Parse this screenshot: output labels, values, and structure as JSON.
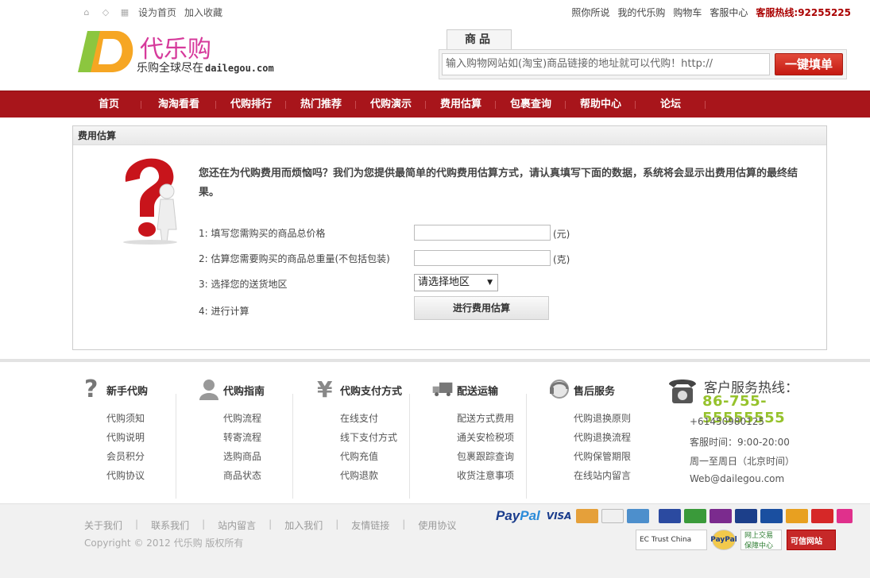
{
  "topbar": {
    "set_home": "设为首页",
    "add_fav": "加入收藏",
    "links": [
      "照你所说",
      "我的代乐购",
      "购物车",
      "客服中心"
    ],
    "hotline_label": "客服热线:",
    "hotline_number": "92255225"
  },
  "logo": {
    "title": "代乐购",
    "subtitle": "乐购全球尽在",
    "domain": "dailegou.com"
  },
  "search": {
    "tab": "商品",
    "placeholder": "输入购物网站如(淘宝)商品链接的地址就可以代购！http://",
    "button": "一键填单"
  },
  "nav": {
    "items": [
      "首页",
      "淘淘看看",
      "代购排行",
      "热门推荐",
      "代购演示",
      "费用估算",
      "包裹查询",
      "帮助中心",
      "论坛"
    ]
  },
  "panel": {
    "title": "费用估算",
    "intro": "您还在为代购费用而烦恼吗？我们为您提供最简单的代购费用估算方式，请认真填写下面的数据，系统将会显示出费用估算的最终结果。",
    "rows": [
      {
        "label": "1: 填写您需购买的商品总价格",
        "unit": "(元)"
      },
      {
        "label": "2: 估算您需要购买的商品总重量(不包括包装)",
        "unit": "(克)"
      },
      {
        "label": "3: 选择您的送货地区"
      },
      {
        "label": "4: 进行计算"
      }
    ],
    "region_select": "请选择地区",
    "calc_button": "进行费用估算"
  },
  "help": {
    "columns": [
      {
        "title": "新手代购",
        "icon": "question-icon",
        "items": [
          "代购须知",
          "代购说明",
          "会员积分",
          "代购协议"
        ]
      },
      {
        "title": "代购指南",
        "icon": "person-icon",
        "items": [
          "代购流程",
          "转寄流程",
          "选购商品",
          "商品状态"
        ]
      },
      {
        "title": "代购支付方式",
        "icon": "yen-icon",
        "items": [
          "在线支付",
          "线下支付方式",
          "代购充值",
          "代购退款"
        ]
      },
      {
        "title": "配送运输",
        "icon": "truck-icon",
        "items": [
          "配送方式费用",
          "通关安检税项",
          "包裹跟踪查询",
          "收货注意事项"
        ]
      },
      {
        "title": "售后服务",
        "icon": "headset-icon",
        "items": [
          "代购退换原则",
          "代购退换流程",
          "代购保管期限",
          "在线站内留言"
        ]
      }
    ]
  },
  "service": {
    "title": "客户服务热线：",
    "number": "86-755-55555555",
    "lines": [
      "+61450980125",
      "客服时间：9:00-20:00",
      "周一至周日（北京时间）",
      "Web@dailegou.com"
    ]
  },
  "bottom": {
    "links": [
      "关于我们",
      "联系我们",
      "站内留言",
      "加入我们",
      "友情链接",
      "使用协议"
    ],
    "copyright": "Copyright © 2012 代乐购 版权所有",
    "paypal_1": "Pay",
    "paypal_2": "Pal",
    "visa": "VISA",
    "trust": [
      "EC Trust China",
      "PayPal",
      "网上交易保障中心",
      "可信网站"
    ]
  },
  "colors": {
    "nav_bg": "#a8151b",
    "hotline": "#aa0000",
    "service_number": "#96c22c",
    "logo_title": "#d63a9b"
  }
}
